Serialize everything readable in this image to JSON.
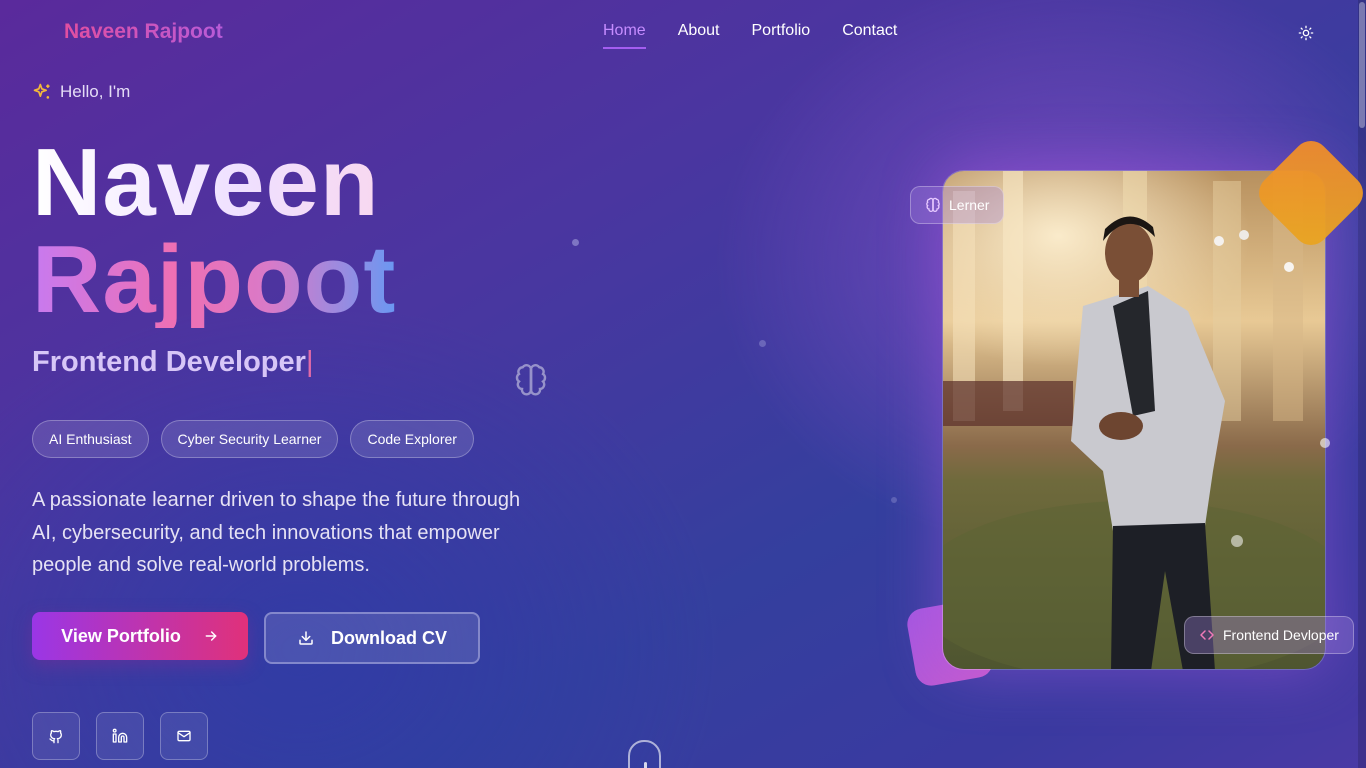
{
  "brand": {
    "name": "Naveen Rajpoot"
  },
  "nav": {
    "items": [
      {
        "label": "Home",
        "active": true
      },
      {
        "label": "About",
        "active": false
      },
      {
        "label": "Portfolio",
        "active": false
      },
      {
        "label": "Contact",
        "active": false
      }
    ],
    "theme_toggle_icon": "sun-icon"
  },
  "hero": {
    "greeting": "Hello, I'm",
    "greeting_icon": "sparkles-icon",
    "first_name": "Naveen",
    "last_name": "Rajpoot",
    "role": "Frontend Developer",
    "tags": [
      "AI Enthusiast",
      "Cyber Security Learner",
      "Code Explorer"
    ],
    "description": "A passionate learner driven to shape the future through AI, cybersecurity, and tech innovations that empower people and solve real-world problems.",
    "primary_button": {
      "label": "View Portfolio",
      "icon": "arrow-right-icon"
    },
    "secondary_button": {
      "label": "Download CV",
      "icon": "download-icon"
    },
    "socials": [
      {
        "name": "github",
        "icon": "github-icon"
      },
      {
        "name": "linkedin",
        "icon": "linkedin-icon"
      },
      {
        "name": "email",
        "icon": "mail-icon"
      }
    ]
  },
  "profile": {
    "badge_top": {
      "label": "Lerner",
      "icon": "brain-icon"
    },
    "badge_bottom": {
      "label": "Frontend Devloper",
      "icon": "code-icon"
    }
  },
  "colors": {
    "accent_purple": "#a45df0",
    "accent_pink": "#e0317a",
    "orange_deco": "#f08a2c"
  }
}
